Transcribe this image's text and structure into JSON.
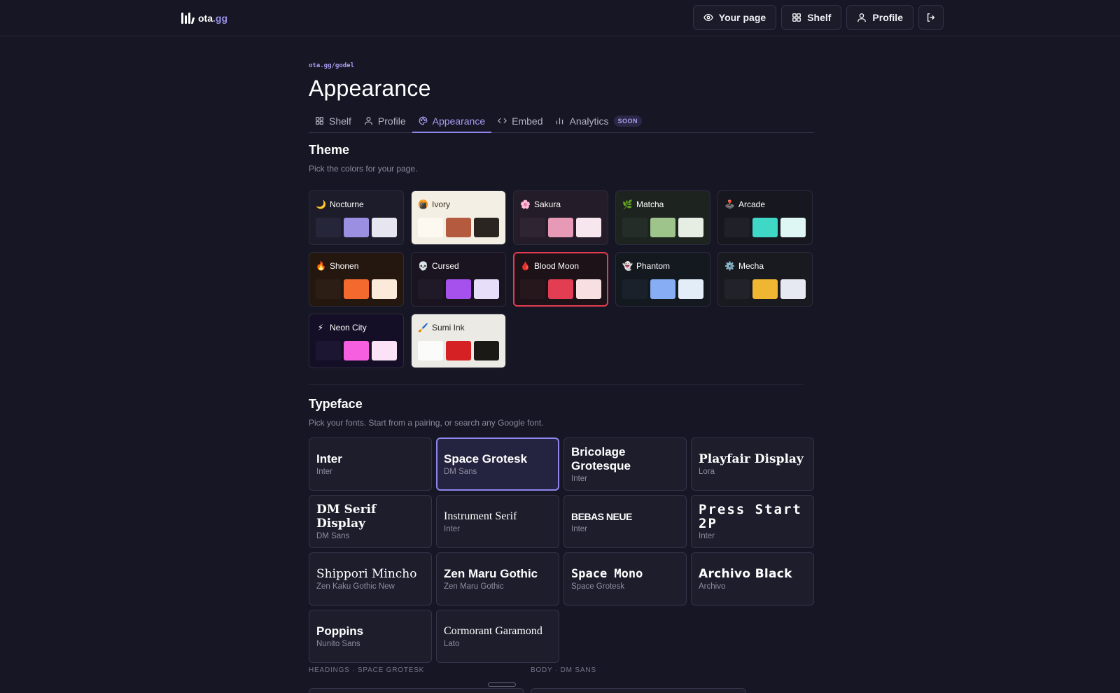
{
  "brand": {
    "name_main": "ota",
    "name_accent": ".gg"
  },
  "nav": {
    "your_page": "Your page",
    "shelf": "Shelf",
    "profile": "Profile"
  },
  "breadcrumb": "ota.gg/godel",
  "page_title": "Appearance",
  "tabs": [
    {
      "label": "Shelf",
      "icon": "grid-icon"
    },
    {
      "label": "Profile",
      "icon": "user-icon"
    },
    {
      "label": "Appearance",
      "icon": "palette-icon",
      "active": true
    },
    {
      "label": "Embed",
      "icon": "code-icon"
    },
    {
      "label": "Analytics",
      "icon": "bar-chart-icon",
      "badge": "SOON"
    }
  ],
  "theme": {
    "title": "Theme",
    "subtitle": "Pick the colors for your page.",
    "selected": "Blood Moon",
    "items": [
      {
        "name": "Nocturne",
        "icon": "🌙",
        "bg": "#1c1c2a",
        "text": "#ffffff",
        "swatches": [
          "#26263a",
          "#9a8fe0",
          "#e7e6f0"
        ]
      },
      {
        "name": "Ivory",
        "icon": "🍘",
        "bg": "#f4efe4",
        "text": "#3a2e22",
        "swatches": [
          "#fdf9f0",
          "#b35a3f",
          "#2a2520"
        ]
      },
      {
        "name": "Sakura",
        "icon": "🌸",
        "bg": "#241c28",
        "text": "#ffffff",
        "swatches": [
          "#2f2432",
          "#e69ab6",
          "#f7e6ee"
        ]
      },
      {
        "name": "Matcha",
        "icon": "🌿",
        "bg": "#1d2420",
        "text": "#ffffff",
        "swatches": [
          "#252d28",
          "#9fc48b",
          "#e6ede3"
        ]
      },
      {
        "name": "Arcade",
        "icon": "🕹️",
        "bg": "#17171f",
        "text": "#ffffff",
        "swatches": [
          "#202029",
          "#3fd8c6",
          "#def6f4"
        ]
      },
      {
        "name": "Shonen",
        "icon": "🔥",
        "bg": "#24170f",
        "text": "#ffffff",
        "swatches": [
          "#2c1e15",
          "#f46a2e",
          "#fbe9d9"
        ]
      },
      {
        "name": "Cursed",
        "icon": "💀",
        "bg": "#19141f",
        "text": "#ffffff",
        "swatches": [
          "#201a28",
          "#a650ee",
          "#e7defa"
        ]
      },
      {
        "name": "Blood Moon",
        "icon": "🩸",
        "bg": "#1d1218",
        "text": "#ffffff",
        "swatches": [
          "#26171d",
          "#e23d52",
          "#f7dfe2"
        ]
      },
      {
        "name": "Phantom",
        "icon": "👻",
        "bg": "#141920",
        "text": "#ffffff",
        "swatches": [
          "#1a212a",
          "#87aef4",
          "#e2edf8"
        ]
      },
      {
        "name": "Mecha",
        "icon": "⚙️",
        "bg": "#191a20",
        "text": "#ffffff",
        "swatches": [
          "#22232a",
          "#efb631",
          "#e7e9f2"
        ]
      },
      {
        "name": "Neon City",
        "icon": "⚡",
        "bg": "#140f26",
        "text": "#ffffff",
        "swatches": [
          "#1c1632",
          "#f55fe0",
          "#fbe2f6"
        ]
      },
      {
        "name": "Sumi Ink",
        "icon": "🖌️",
        "bg": "#eceae4",
        "text": "#2a2a2a",
        "swatches": [
          "#fbfbf9",
          "#d52024",
          "#1b1915"
        ]
      }
    ]
  },
  "typeface": {
    "title": "Typeface",
    "subtitle": "Pick your fonts. Start from a pairing, or search any Google font.",
    "selected": "Space Grotesk",
    "items": [
      {
        "heading": "Inter",
        "body": "Inter",
        "style": ""
      },
      {
        "heading": "Space Grotesk",
        "body": "DM Sans",
        "style": ""
      },
      {
        "heading": "Bricolage Grotesque",
        "body": "Inter",
        "style": ""
      },
      {
        "heading": "Playfair Display",
        "body": "Lora",
        "style": "fn-serif-b"
      },
      {
        "heading": "DM Serif Display",
        "body": "DM Sans",
        "style": "fn-serif-b"
      },
      {
        "heading": "Instrument Serif",
        "body": "Inter",
        "style": "fn-light-serif"
      },
      {
        "heading": "BEBAS NEUE",
        "body": "Inter",
        "style": "fn-condensed"
      },
      {
        "heading": "Press Start 2P",
        "body": "Inter",
        "style": "fn-pixel"
      },
      {
        "heading": "Shippori Mincho",
        "body": "Zen Kaku Gothic New",
        "style": "fn-serif"
      },
      {
        "heading": "Zen Maru Gothic",
        "body": "Zen Maru Gothic",
        "style": ""
      },
      {
        "heading": "Space Mono",
        "body": "Space Grotesk",
        "style": "fn-mono"
      },
      {
        "heading": "Archivo Black",
        "body": "Archivo",
        "style": "fn-black"
      },
      {
        "heading": "Poppins",
        "body": "Nunito Sans",
        "style": ""
      },
      {
        "heading": "Cormorant Garamond",
        "body": "Lato",
        "style": "fn-cormorant"
      }
    ],
    "headings_label": "HEADINGS · SPACE GROTESK",
    "body_label": "BODY · DM SANS"
  },
  "colors": {
    "accent": "#8f86ee",
    "selected_theme_border": "#e23d52",
    "background": "#161624"
  }
}
